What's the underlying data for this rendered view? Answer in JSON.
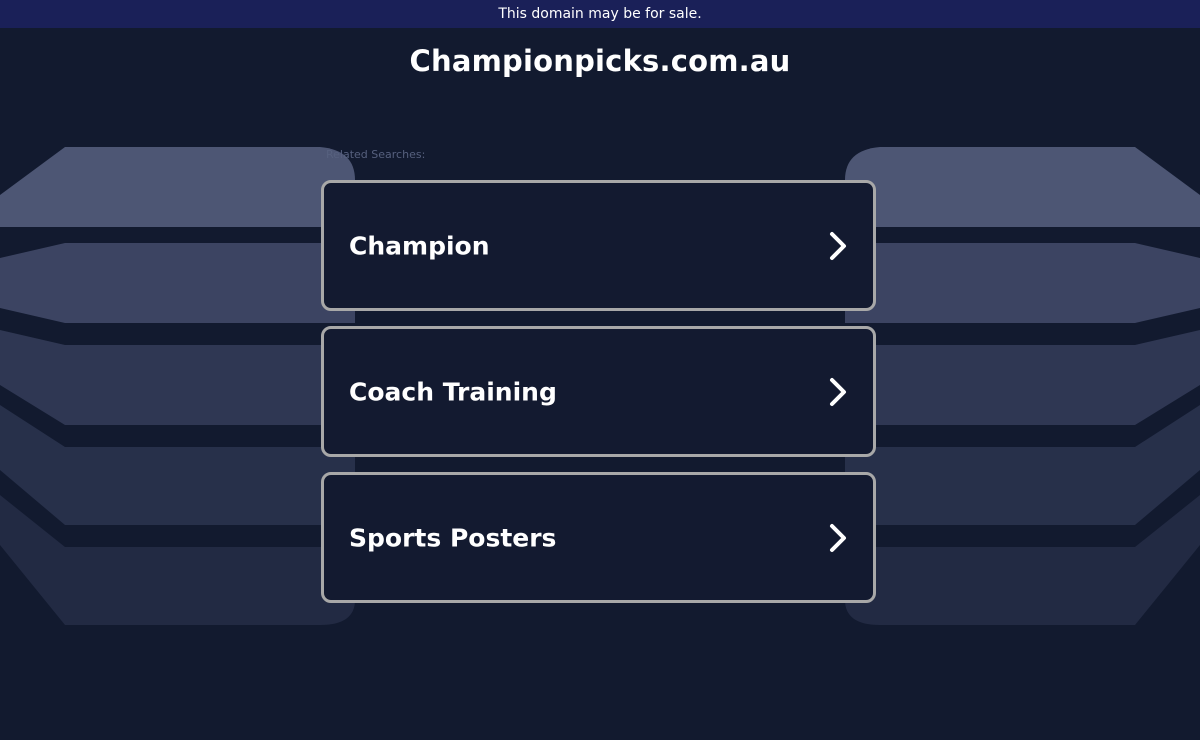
{
  "banner": {
    "text": "This domain may be for sale."
  },
  "domain": {
    "title": "Championpicks.com.au"
  },
  "related": {
    "label": "Related Searches:",
    "links": [
      {
        "label": "Champion",
        "icon": "chevron-right-icon"
      },
      {
        "label": "Coach Training",
        "icon": "chevron-right-icon"
      },
      {
        "label": "Sports Posters",
        "icon": "chevron-right-icon"
      }
    ]
  },
  "colors": {
    "background": "#121a2f",
    "banner": "#1a2058",
    "link_border": "#a8a8a8",
    "link_background": "#131a30",
    "text": "#ffffff"
  }
}
